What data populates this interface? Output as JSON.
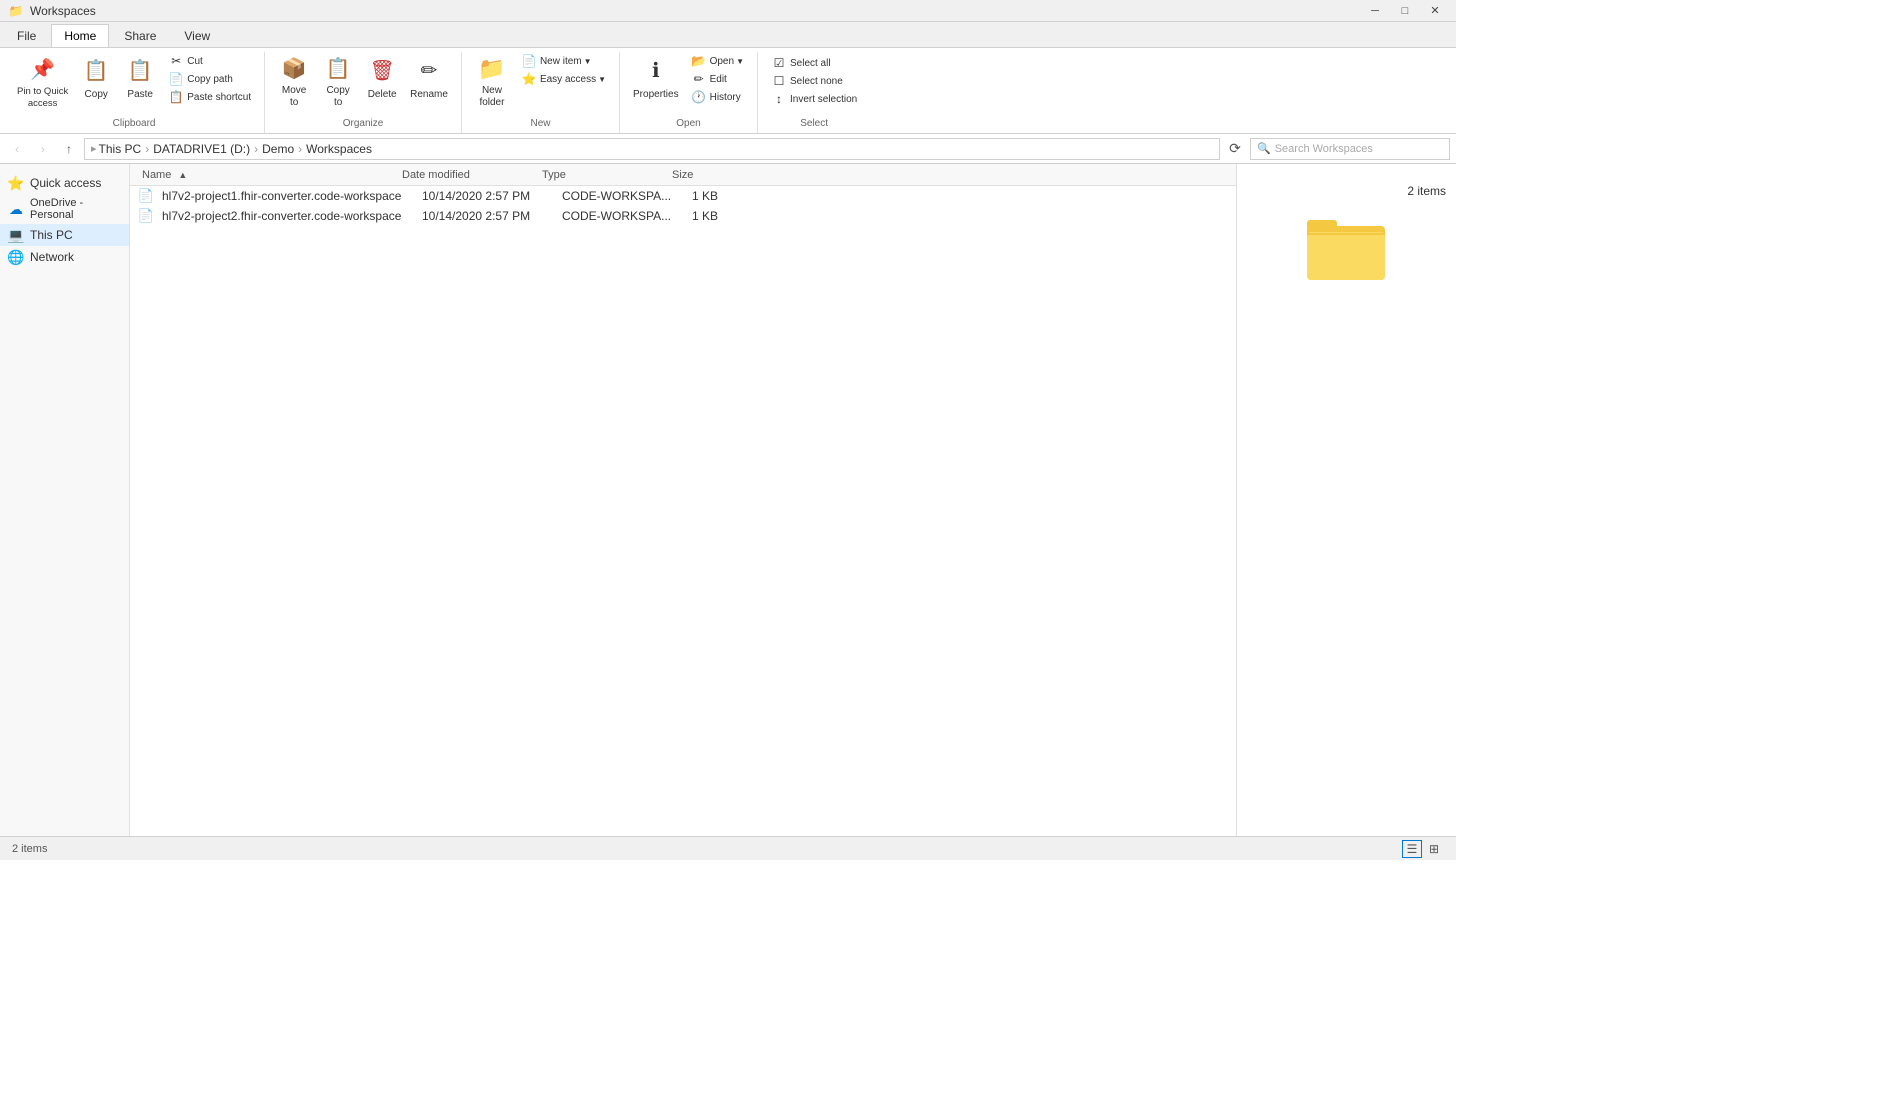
{
  "titlebar": {
    "title": "Workspaces",
    "icon": "📁",
    "minimize": "─",
    "maximize": "□",
    "close": "✕"
  },
  "ribbon": {
    "tabs": [
      "File",
      "Home",
      "Share",
      "View"
    ],
    "active_tab": "Home",
    "groups": {
      "clipboard": {
        "label": "Clipboard",
        "pin_label": "Pin to Quick\naccess",
        "copy_label": "Copy",
        "paste_label": "Paste",
        "cut_label": "Cut",
        "copy_path_label": "Copy path",
        "paste_shortcut_label": "Paste shortcut"
      },
      "organize": {
        "label": "Organize",
        "move_to_label": "Move\nto",
        "copy_to_label": "Copy\nto",
        "delete_label": "Delete",
        "rename_label": "Rename"
      },
      "new": {
        "label": "New",
        "new_folder_label": "New\nfolder",
        "new_item_label": "New item",
        "easy_access_label": "Easy access"
      },
      "open": {
        "label": "Open",
        "properties_label": "Properties",
        "open_label": "Open",
        "edit_label": "Edit",
        "history_label": "History"
      },
      "select": {
        "label": "Select",
        "select_all_label": "Select all",
        "select_none_label": "Select none",
        "invert_label": "Invert selection"
      }
    }
  },
  "addressbar": {
    "back_disabled": true,
    "forward_disabled": true,
    "up_disabled": false,
    "crumbs": [
      "This PC",
      "DATADRIVE1 (D:)",
      "Demo",
      "Workspaces"
    ],
    "search_placeholder": "Search Workspaces"
  },
  "sidebar": {
    "items": [
      {
        "label": "Quick access",
        "icon": "⭐",
        "active": false
      },
      {
        "label": "OneDrive - Personal",
        "icon": "☁",
        "active": false
      },
      {
        "label": "This PC",
        "icon": "💻",
        "active": true
      },
      {
        "label": "Network",
        "icon": "🖧",
        "active": false
      }
    ]
  },
  "files": {
    "columns": [
      "Name",
      "Date modified",
      "Type",
      "Size"
    ],
    "rows": [
      {
        "name": "hl7v2-project1.fhir-converter.code-workspace",
        "date": "10/14/2020 2:57 PM",
        "type": "CODE-WORKSPA...",
        "size": "1 KB",
        "icon": "📄"
      },
      {
        "name": "hl7v2-project2.fhir-converter.code-workspace",
        "date": "10/14/2020 2:57 PM",
        "type": "CODE-WORKSPA...",
        "size": "1 KB",
        "icon": "📄"
      }
    ]
  },
  "preview": {
    "item_count": "2 items"
  },
  "statusbar": {
    "text": "2 items",
    "view_icons": [
      "▤",
      "⊞"
    ]
  }
}
